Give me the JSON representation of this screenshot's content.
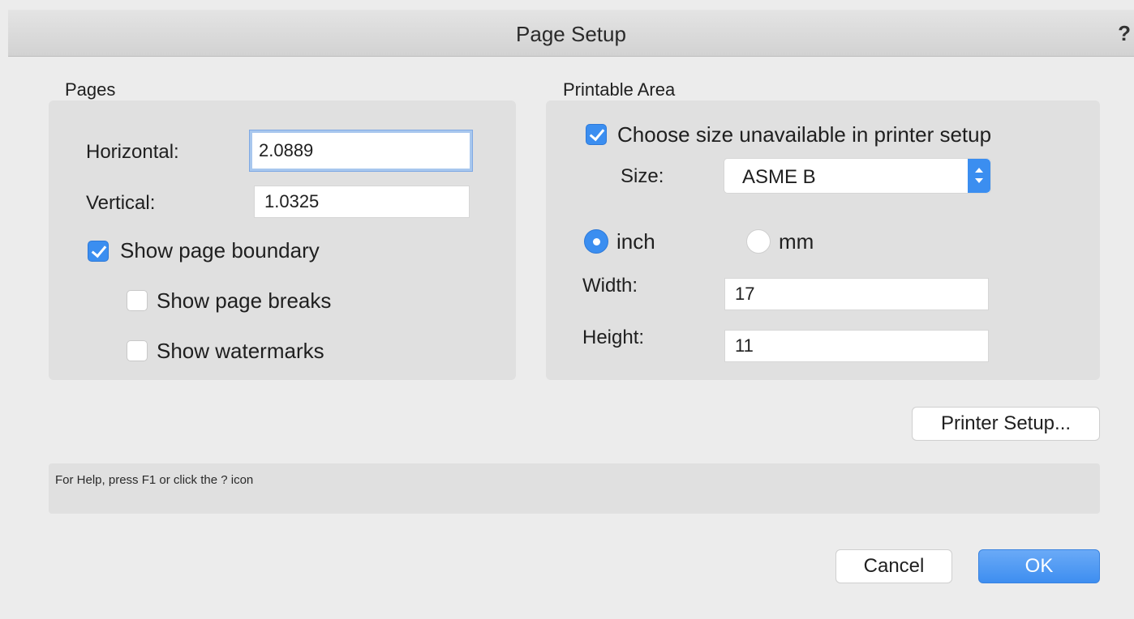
{
  "window": {
    "title": "Page Setup",
    "help_label": "?"
  },
  "pages": {
    "group_label": "Pages",
    "horizontal_label": "Horizontal:",
    "horizontal_value": "2.0889",
    "vertical_label": "Vertical:",
    "vertical_value": "1.0325",
    "show_page_boundary": {
      "label": "Show page boundary",
      "checked": true
    },
    "show_page_breaks": {
      "label": "Show page breaks",
      "checked": false
    },
    "show_watermarks": {
      "label": "Show watermarks",
      "checked": false
    }
  },
  "printable_area": {
    "group_label": "Printable Area",
    "choose_size": {
      "label": "Choose size unavailable in printer setup",
      "checked": true
    },
    "size_label": "Size:",
    "size_value": "ASME B",
    "unit_inch": {
      "label": "inch",
      "selected": true
    },
    "unit_mm": {
      "label": "mm",
      "selected": false
    },
    "width_label": "Width:",
    "width_value": "17",
    "height_label": "Height:",
    "height_value": "11"
  },
  "buttons": {
    "printer_setup": "Printer Setup...",
    "cancel": "Cancel",
    "ok": "OK"
  },
  "status": {
    "help_text": "For Help, press F1 or click the ? icon"
  },
  "colors": {
    "accent": "#3b8ef0",
    "background": "#ececec",
    "group_background": "#e0e0e0"
  }
}
